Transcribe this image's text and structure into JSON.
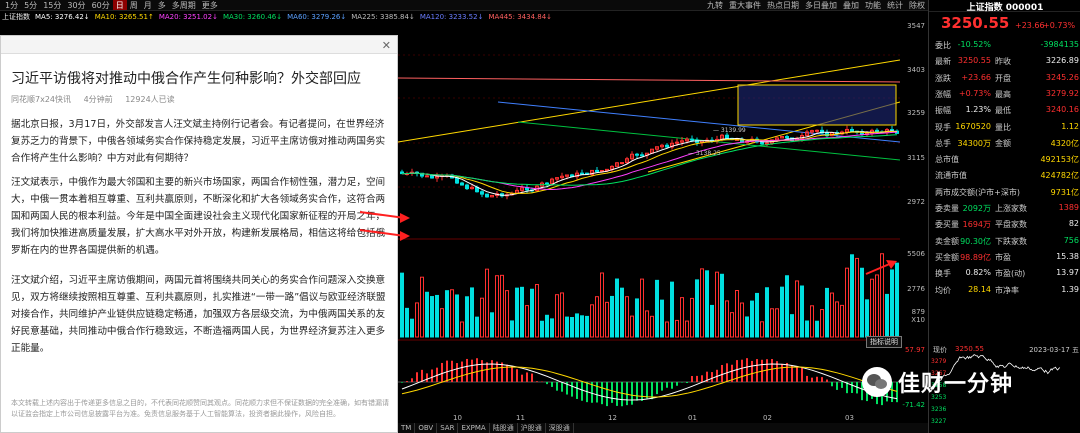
{
  "toolbar": {
    "tabs": [
      "1分",
      "5分",
      "15分",
      "30分",
      "60分",
      "日",
      "周",
      "月",
      "多",
      "多周期",
      "更多"
    ],
    "active": "日",
    "right_items": [
      "九转",
      "重大事件",
      "热点日期",
      "多日叠加",
      "叠加",
      "功能",
      "统计",
      "除权"
    ]
  },
  "ma": {
    "index": "上证指数",
    "items": [
      {
        "label": "MA5: 3276.42↓",
        "color": "#ffffff"
      },
      {
        "label": "MA10: 3265.51↑",
        "color": "#ffd800"
      },
      {
        "label": "MA20: 3251.02↓",
        "color": "#ff40ff"
      },
      {
        "label": "MA30: 3260.46↓",
        "color": "#00e060"
      },
      {
        "label": "MA60: 3279.26↓",
        "color": "#5aa0ff"
      },
      {
        "label": "MA225: 3385.84↓",
        "color": "#bbbbbb"
      },
      {
        "label": "MA120: 3233.52↓",
        "color": "#6a7dff"
      },
      {
        "label": "MA445: 3434.84↓",
        "color": "#ff6060"
      }
    ]
  },
  "article": {
    "title": "习近平访俄将对推动中俄合作产生何种影响？外交部回应",
    "source": "同花顺7x24快讯",
    "time": "4分钟前",
    "reads": "12924人已读",
    "close": "✕",
    "paragraphs": [
      "据北京日报，3月17日，外交部发言人汪文斌主持例行记者会。有记者提问，在世界经济复苏乏力的背景下，中俄各领域务实合作保持稳定发展，习近平主席访俄对推动两国务实合作将产生什么影响？中方对此有何期待？",
      "汪文斌表示，中俄作为最大邻国和主要的新兴市场国家，两国合作韧性强，潜力足，空间大，中俄一贯本着相互尊重、互利共赢原则，不断深化和扩大各领域务实合作，这符合两国和两国人民的根本利益。今年是中国全面建设社会主义现代化国家新征程的开局之年，我们将加快推进高质量发展，扩大高水平对外开放，构建新发展格局，相信这将给包括俄罗斯在内的世界各国提供新的机遇。",
      "汪文斌介绍，习近平主席访俄期间，两国元首将围绕共同关心的务实合作问题深入交换意见，双方将继续按照相互尊重、互利共赢原则，扎实推进“一带一路”倡议与欧亚经济联盟对接合作，共同维护产业链供应链稳定畅通，加强双方各层级交流，为中俄两国关系的友好民意基础，共同推动中俄合作行稳致远，不断造福两国人民，为世界经济复苏注入更多正能量。"
    ],
    "disclaimer": "本文转载上述内容出于传递更多信息之目的，不代表同花顺赞同其观点。同花顺力求但不保证数据的完全准确，如有错漏请以证监会指定上市公司信息披露平台为准。免责信息服务基于人工智能算法，投资者据此操作，风险自担。"
  },
  "price_axis": [
    "3547",
    "3403",
    "3259",
    "3115",
    "2972"
  ],
  "vol_axis": [
    "5506",
    "2776",
    "879"
  ],
  "vol_unit": "X10",
  "macd_axis": [
    "57.97",
    "-71.42"
  ],
  "chart_annotations": [
    "3139.99",
    "3138.25"
  ],
  "month_axis": [
    "10",
    "11",
    "12",
    "01",
    "02",
    "03"
  ],
  "bottom_tabs": [
    "TM",
    "OBV",
    "SAR",
    "EXPMA",
    "陆股通",
    "沪股通",
    "深股通"
  ],
  "indicator_btn": "指标说明",
  "quote": {
    "title": "上证指数 000001",
    "price": "3250.55",
    "change": "+23.66",
    "pct": "+0.73%",
    "rows": [
      {
        "l1": "委比",
        "v1": "-10.52%",
        "c1": "green",
        "l2": "",
        "v2": "-3984135",
        "c2": "green"
      },
      {
        "l1": "最新",
        "v1": "3250.55",
        "c1": "red",
        "l2": "昨收",
        "v2": "3226.89",
        "c2": "white"
      },
      {
        "l1": "涨跌",
        "v1": "+23.66",
        "c1": "red",
        "l2": "开盘",
        "v2": "3245.26",
        "c2": "red"
      },
      {
        "l1": "涨幅",
        "v1": "+0.73%",
        "c1": "red",
        "l2": "最高",
        "v2": "3279.92",
        "c2": "red"
      },
      {
        "l1": "振幅",
        "v1": "1.23%",
        "c1": "white",
        "l2": "最低",
        "v2": "3240.16",
        "c2": "red"
      },
      {
        "l1": "现手",
        "v1": "1670520",
        "c1": "yellow",
        "l2": "量比",
        "v2": "1.12",
        "c2": "yellow"
      },
      {
        "l1": "总手",
        "v1": "34300万",
        "c1": "yellow",
        "l2": "金额",
        "v2": "4320亿",
        "c2": "yellow"
      },
      {
        "l1": "总市值",
        "v1": "",
        "c1": "white",
        "l2": "",
        "v2": "492153亿",
        "c2": "yellow"
      },
      {
        "l1": "流通市值",
        "v1": "",
        "c1": "white",
        "l2": "",
        "v2": "424782亿",
        "c2": "yellow"
      },
      {
        "l1": "两市成交额(沪市+深市)",
        "v1": "",
        "c1": "white",
        "l2": "",
        "v2": "9731亿",
        "c2": "yellow"
      },
      {
        "l1": "委卖量",
        "v1": "2092万",
        "c1": "green",
        "l2": "上涨家数",
        "v2": "1389",
        "c2": "red"
      },
      {
        "l1": "委买量",
        "v1": "1694万",
        "c1": "red",
        "l2": "平盘家数",
        "v2": "82",
        "c2": "white"
      },
      {
        "l1": "卖金额",
        "v1": "90.30亿",
        "c1": "green",
        "l2": "下跌家数",
        "v2": "756",
        "c2": "green"
      },
      {
        "l1": "买金额",
        "v1": "98.89亿",
        "c1": "red",
        "l2": "市盈",
        "v2": "15.38",
        "c2": "white"
      },
      {
        "l1": "换手",
        "v1": "0.82%",
        "c1": "white",
        "l2": "市盈(动)",
        "v2": "13.97",
        "c2": "white"
      },
      {
        "l1": "均价",
        "v1": "28.14",
        "c1": "yellow",
        "l2": "市净率",
        "v2": "1.39",
        "c2": "white"
      }
    ],
    "mini_label": "现价",
    "mini_price": "3250.55",
    "mini_date": "2023-03-17 五",
    "mini_axis": [
      "3279",
      "3267",
      "3258",
      "3253",
      "3236",
      "3227"
    ]
  },
  "watermark": "佳财一分钟"
}
